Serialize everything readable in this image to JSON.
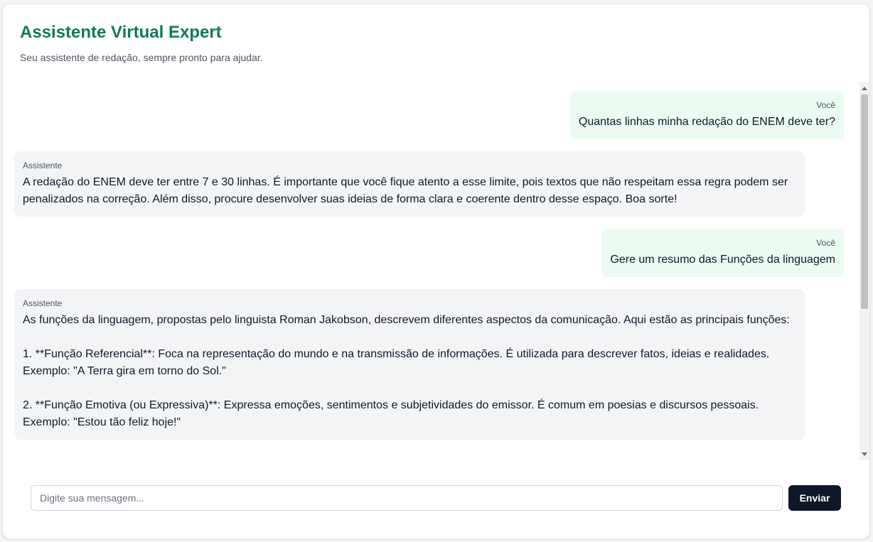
{
  "header": {
    "title": "Assistente Virtual Expert",
    "subtitle": "Seu assistente de redação, sempre pronto para ajudar."
  },
  "messages": [
    {
      "role": "Você",
      "type": "user",
      "text": "Quantas linhas minha redação do ENEM deve ter?"
    },
    {
      "role": "Assistente",
      "type": "assistant",
      "text": "A redação do ENEM deve ter entre 7 e 30 linhas. É importante que você fique atento a esse limite, pois textos que não respeitam essa regra podem ser penalizados na correção. Além disso, procure desenvolver suas ideias de forma clara e coerente dentro desse espaço. Boa sorte!"
    },
    {
      "role": "Você",
      "type": "user",
      "text": "Gere um resumo das Funções da linguagem"
    },
    {
      "role": "Assistente",
      "type": "assistant",
      "text": "As funções da linguagem, propostas pelo linguista Roman Jakobson, descrevem diferentes aspectos da comunicação. Aqui estão as principais funções:\n\n1. **Função Referencial**: Foca na representação do mundo e na transmissão de informações. É utilizada para descrever fatos, ideias e realidades. Exemplo: \"A Terra gira em torno do Sol.\"\n\n2. **Função Emotiva (ou Expressiva)**: Expressa emoções, sentimentos e subjetividades do emissor. É comum em poesias e discursos pessoais. Exemplo: \"Estou tão feliz hoje!\""
    }
  ],
  "composer": {
    "placeholder": "Digite sua mensagem...",
    "value": "",
    "send_label": "Enviar"
  },
  "colors": {
    "title": "#107c52",
    "user_bubble": "#ebfbf2",
    "assistant_bubble": "#f3f4f6",
    "send_button": "#0f172a"
  }
}
